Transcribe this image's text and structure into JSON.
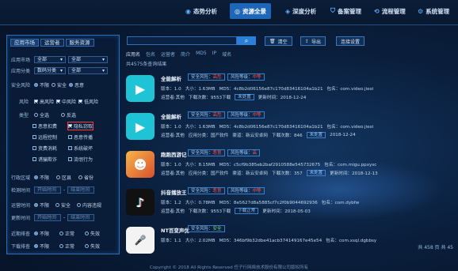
{
  "nav": [
    {
      "label": "态势分析",
      "icon": "eye-icon"
    },
    {
      "label": "资源全景",
      "icon": "globe-icon",
      "active": true
    },
    {
      "label": "深度分析",
      "icon": "target-icon"
    },
    {
      "label": "备案管理",
      "icon": "shield-icon"
    },
    {
      "label": "流程管理",
      "icon": "flow-icon"
    },
    {
      "label": "系统管理",
      "icon": "gear-icon"
    }
  ],
  "left": {
    "tabs": [
      "应用市场",
      "运营者",
      "服务资源"
    ],
    "market_label": "应用市场",
    "market_sel1": "全部",
    "market_sel2": "全部",
    "cat_label": "应用分类",
    "cat_sel1": "数码分类",
    "cat_sel2": "全部",
    "safe_label": "安全风险",
    "safe_opts": [
      "不限",
      "安全",
      "恶意"
    ],
    "risk_label": "风险",
    "risk_opts": [
      "高风险",
      "中风险",
      "低风险"
    ],
    "type_label": "类型",
    "type_opts": [
      "全选",
      "反选",
      "恶意扣费",
      "隐私窃取",
      "远程控制",
      "恶意传播",
      "资费消耗",
      "系统破坏",
      "诱骗欺诈",
      "流氓行为"
    ],
    "region_label": "行政区域",
    "region_opts": [
      "不限",
      "区县",
      "省份"
    ],
    "time_label": "检测时间",
    "time_from": "开始时间",
    "time_to": "结束时间",
    "hold_label": "运营时间",
    "hold_opts": [
      "不限",
      "安全",
      "内容违规"
    ],
    "update_label": "更新时间",
    "update_from": "开始时间",
    "update_to": "结束时间",
    "recent_label": "近期排查",
    "recent_opts": [
      "不限",
      "正常",
      "失效"
    ],
    "down_label": "下载排查",
    "down_opts": [
      "不限",
      "正常",
      "失效"
    ]
  },
  "main": {
    "search_placeholder": "",
    "clear": "清空",
    "export": "导出",
    "advanced": "连接设置",
    "fields": [
      "应用名",
      "包名",
      "运营者",
      "简介",
      "MD5",
      "IP",
      "域名"
    ],
    "total": "共4575条查询结果",
    "apps": [
      {
        "name": "全能解析",
        "safe": "安全风险：",
        "safe_v": "高危",
        "risk": "风险等级：",
        "risk_v": "中等",
        "ver": "版本：1.0",
        "size": "大小：1.63MB",
        "md5": "MD5：4c8b2d06156e87c170d83416104a1b21",
        "pkg": "包名：com.video.jiexi",
        "op": "运营者:其他",
        "dl": "下载次数：9553下载",
        "tag": "未处置",
        "date": "更新时间：2018-12-24",
        "color": "#1fc3d6",
        "icon": "video-icon",
        "glyph": "▶"
      },
      {
        "name": "全能解析",
        "safe": "安全风险：",
        "safe_v": "高危",
        "risk": "风险等级：",
        "risk_v": "中等",
        "ver": "版本：1.0",
        "size": "大小：1.63MB",
        "md5": "MD5：4c8b2d06156e87c170d83416104a1b21",
        "pkg": "包名：com.video.jiexi",
        "op": "运营者:其他",
        "dl": "应用分类：国产软件",
        "dl2": "渠道：新云安卓网",
        "cnt": "下载次数：846",
        "tag": "未处置",
        "date": "2018-12-24",
        "color": "#1fc3d6",
        "icon": "video-icon",
        "glyph": "▶"
      },
      {
        "name": "跑跑西游记",
        "safe": "安全风险：",
        "safe_v": "恶意",
        "risk": "风险等级：",
        "risk_v": "高",
        "ver": "版本：1.0",
        "size": "大小：8.15MB",
        "md5": "MD5：c5cf9b385eb2baf2910588e545732675",
        "pkg": "包名：com.migu.ppxysc",
        "op": "运营者:其他",
        "dl": "应用分类：国产软件",
        "dl2": "渠道：新云安卓网",
        "cnt": "下载次数：357",
        "tag": "未处置",
        "date": "更新时间：2018-12-13",
        "color": "#e8883a",
        "icon": "game-icon",
        "glyph": "☻"
      },
      {
        "name": "抖音播放王",
        "safe": "安全风险：",
        "safe_v": "恶意",
        "risk": "风险等级：",
        "risk_v": "中等",
        "ver": "版本：1.2",
        "size": "大小：0.78MB",
        "md5": "MD5：8e5627d8a5885cf7c2f0b9044692936",
        "pkg": "包名：com.dybfw",
        "op": "运营者:其他",
        "dl": "下载次数：9553下载",
        "tag": "下载正常",
        "date": "更新时间：2018-05-03",
        "color": "#ffffff",
        "icon": "tiktok-icon",
        "glyph": "♪"
      },
      {
        "name": "NT百变声优",
        "safe": "安全风险：",
        "safe_v": "安全",
        "risk": "",
        "risk_v": "",
        "ver": "版本：1.1",
        "size": "大小：2.02MB",
        "md5": "MD5：346bf9b32dbe41acb374149167e45e54",
        "pkg": "包名：com.xsql.dgbbsy",
        "op": "",
        "dl": "",
        "tag": "",
        "date": "",
        "color": "#ffffff",
        "icon": "mic-icon",
        "glyph": "🎤"
      }
    ],
    "page_info": "共 458 页   共 45"
  },
  "footer": "Copyright © 2018 All Rights Reserved 任子行网络技术股份有限公司版权所有"
}
